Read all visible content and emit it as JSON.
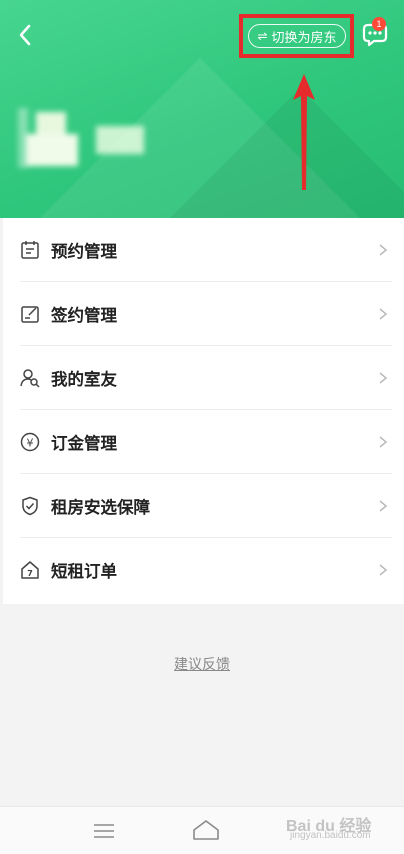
{
  "header": {
    "switch_label": "切换为房东",
    "swap_glyph": "⇌",
    "chat_badge_count": "1",
    "theme_color": "#2fc77c",
    "highlight_color": "#e52b2b"
  },
  "menu": {
    "items": [
      {
        "label": "预约管理",
        "icon": "calendar-icon"
      },
      {
        "label": "签约管理",
        "icon": "contract-edit-icon"
      },
      {
        "label": "我的室友",
        "icon": "roommate-search-icon"
      },
      {
        "label": "订金管理",
        "icon": "yuan-coin-icon"
      },
      {
        "label": "租房安选保障",
        "icon": "shield-check-icon"
      },
      {
        "label": "短租订单",
        "icon": "house-seven-icon"
      }
    ]
  },
  "feedback_label": "建议反馈",
  "watermark": {
    "main": "Bai du 经验",
    "sub": "jingyan.baidu.com"
  }
}
